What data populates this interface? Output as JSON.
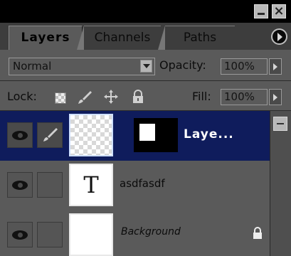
{
  "tabs": [
    "Layers",
    "Channels",
    "Paths"
  ],
  "blend_mode": "Normal",
  "opacity": {
    "label": "Opacity:",
    "value": "100%"
  },
  "lock": {
    "label": "Lock:"
  },
  "fill": {
    "label": "Fill:",
    "value": "100%"
  },
  "layers": [
    {
      "name": "Laye...",
      "selected": true
    },
    {
      "name": "asdfasdf",
      "thumb_text": "T"
    },
    {
      "name": "Background",
      "locked": true
    }
  ],
  "icons": [
    "minimize-icon",
    "close-icon",
    "panel-menu-icon",
    "eye-icon",
    "brush-icon",
    "move-icon",
    "lock-icon"
  ],
  "colors": {
    "panel_bg": "#5a5a5a",
    "selected_row": "#0f1c5c",
    "title_bar": "#000000"
  }
}
